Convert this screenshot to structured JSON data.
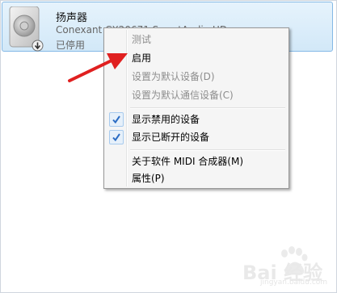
{
  "device": {
    "name": "扬声器",
    "driver": "Conexant CX20671 SmartAudio HD",
    "status": "已停用",
    "icon": "speaker-icon",
    "badge_icon": "down-arrow-badge-icon"
  },
  "context_menu": {
    "items": [
      {
        "label": "测试",
        "enabled": false,
        "checked": false
      },
      {
        "label": "启用",
        "enabled": true,
        "checked": false
      },
      {
        "label": "设置为默认设备(D)",
        "enabled": false,
        "checked": false
      },
      {
        "label": "设置为默认通信设备(C)",
        "enabled": false,
        "checked": false
      },
      {
        "label": "显示禁用的设备",
        "enabled": true,
        "checked": true
      },
      {
        "label": "显示已断开的设备",
        "enabled": true,
        "checked": true
      },
      {
        "label": "关于软件 MIDI 合成器(M)",
        "enabled": true,
        "checked": false
      },
      {
        "label": "属性(P)",
        "enabled": true,
        "checked": false
      }
    ]
  },
  "annotation": {
    "arrow_color": "#e02020"
  },
  "watermark": {
    "text": "Bai 经验",
    "sub": "jingyan.baidu.com"
  },
  "colors": {
    "selection": "#d2e8f8",
    "check": "#2b6cc4",
    "disabled_text": "#8d8d8d"
  }
}
